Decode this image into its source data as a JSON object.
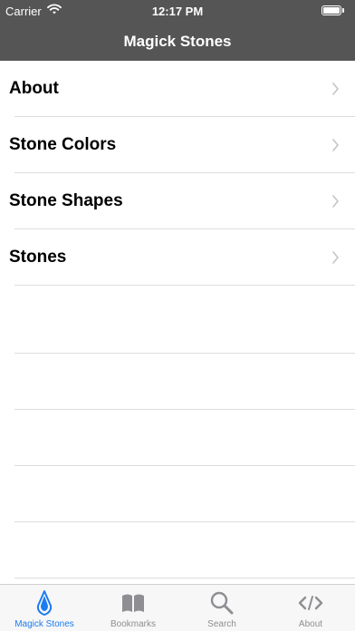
{
  "status_bar": {
    "carrier": "Carrier",
    "time": "12:17 PM"
  },
  "nav": {
    "title": "Magick Stones"
  },
  "list": {
    "items": [
      {
        "label": "About"
      },
      {
        "label": "Stone Colors"
      },
      {
        "label": "Stone Shapes"
      },
      {
        "label": "Stones"
      }
    ]
  },
  "tabbar": {
    "selected": "Magick Stones",
    "active_color": "#1c7cf2",
    "inactive_color": "#8e8e93",
    "tabs": [
      {
        "label": "Magick Stones",
        "icon": "stone-icon"
      },
      {
        "label": "Bookmarks",
        "icon": "book-icon"
      },
      {
        "label": "Search",
        "icon": "magnifier-icon"
      },
      {
        "label": "About",
        "icon": "code-icon"
      }
    ]
  },
  "colors": {
    "header": "#555555"
  }
}
